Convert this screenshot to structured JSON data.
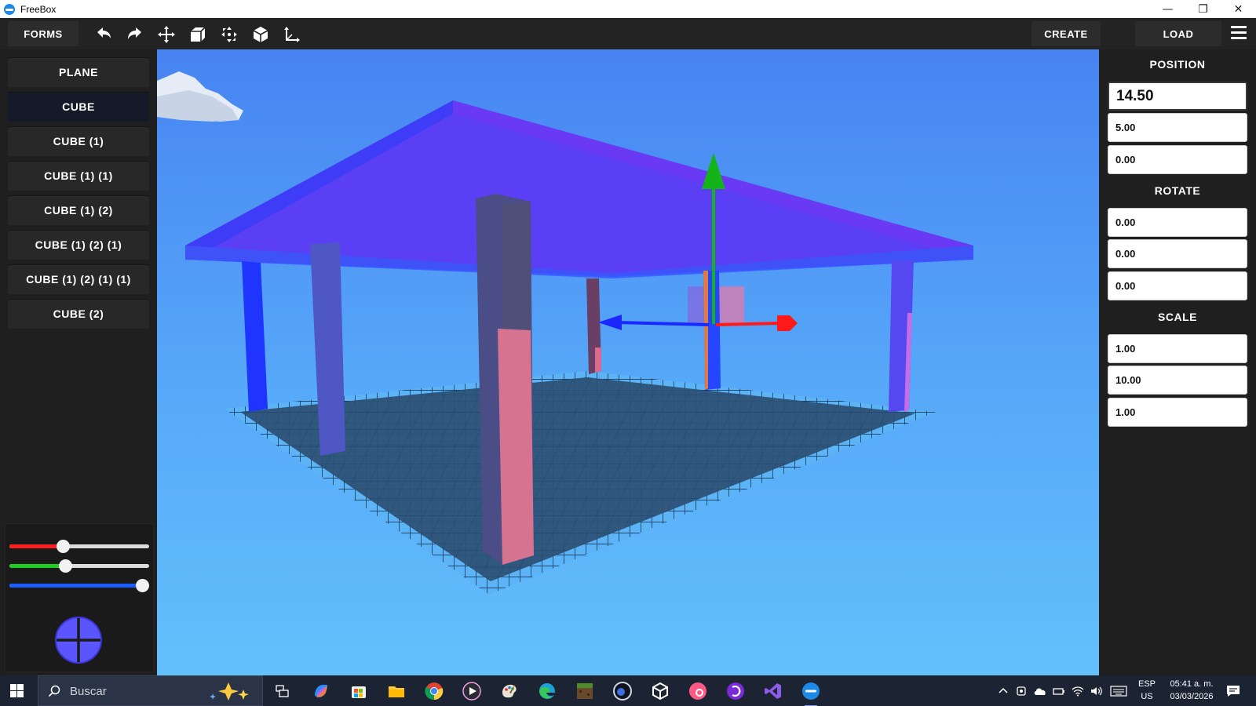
{
  "window": {
    "title": "FreeBox",
    "minimize": "—",
    "maximize": "❐",
    "close": "✕"
  },
  "toolbar": {
    "forms_label": "FORMS",
    "create_label": "CREATE",
    "load_label": "LOAD",
    "tools": [
      "undo-icon",
      "redo-icon",
      "move-icon",
      "scale-icon",
      "expand-icon",
      "cube-icon",
      "axis-icon"
    ]
  },
  "objects": [
    {
      "label": "PLANE",
      "selected": false
    },
    {
      "label": "CUBE",
      "selected": true
    },
    {
      "label": "CUBE (1)",
      "selected": false
    },
    {
      "label": "CUBE (1) (1)",
      "selected": false
    },
    {
      "label": "CUBE (1) (2)",
      "selected": false
    },
    {
      "label": "CUBE (1) (2) (1)",
      "selected": false
    },
    {
      "label": "CUBE (1) (2) (1) (1)",
      "selected": false
    },
    {
      "label": "CUBE (2)",
      "selected": false
    }
  ],
  "color_sliders": {
    "red": {
      "value": 0.37,
      "color": "#ff1f1f"
    },
    "green": {
      "value": 0.39,
      "color": "#22cc22"
    },
    "blue": {
      "value": 1.0,
      "color": "#1a5cff"
    },
    "preview_color": "#5a55ff"
  },
  "transform": {
    "position_label": "POSITION",
    "position": [
      "14.50",
      "5.00",
      "0.00"
    ],
    "rotate_label": "ROTATE",
    "rotate": [
      "0.00",
      "0.00",
      "0.00"
    ],
    "scale_label": "SCALE",
    "scale": [
      "1.00",
      "10.00",
      "1.00"
    ]
  },
  "taskbar": {
    "search_placeholder": "Buscar",
    "lang_top": "ESP",
    "lang_bottom": "US",
    "time": "05:41 a. m.",
    "date": "03/03/2026"
  },
  "colors": {
    "sky_top": "#4a86f2",
    "sky_bottom": "#62bdfb",
    "roof": "#4a4cff",
    "axis_x": "#ff1a1a",
    "axis_y": "#15b31a",
    "axis_z": "#1a28ff"
  }
}
